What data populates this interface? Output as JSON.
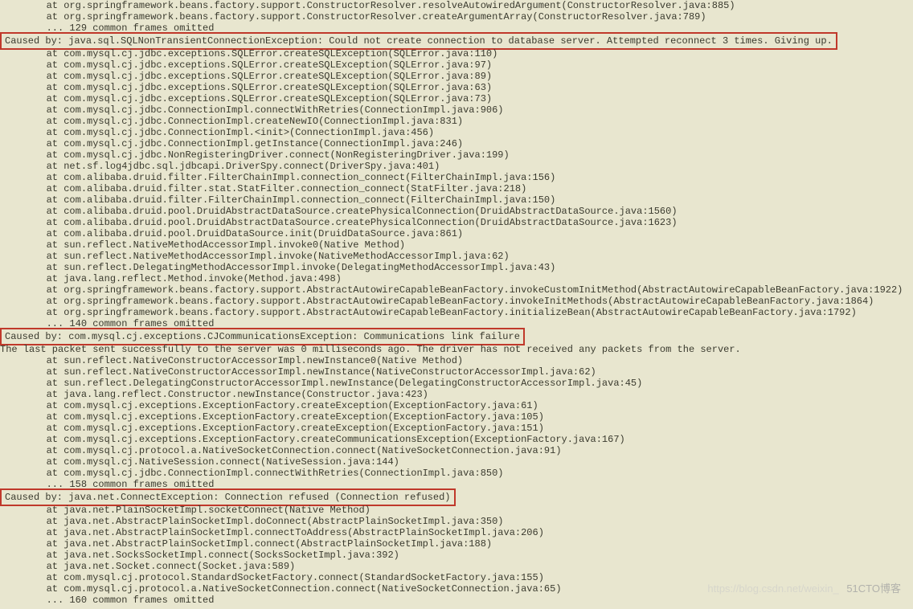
{
  "indent_at": "        at ",
  "indent_dots": "        ... ",
  "stack_top": [
    "org.springframework.beans.factory.support.ConstructorResolver.resolveAutowiredArgument(ConstructorResolver.java:885)",
    "org.springframework.beans.factory.support.ConstructorResolver.createArgumentArray(ConstructorResolver.java:789)"
  ],
  "omitted1": "129 common frames omitted",
  "caused1": "Caused by: java.sql.SQLNonTransientConnectionException: Could not create connection to database server. Attempted reconnect 3 times. Giving up.",
  "stack1": [
    "com.mysql.cj.jdbc.exceptions.SQLError.createSQLException(SQLError.java:110)",
    "com.mysql.cj.jdbc.exceptions.SQLError.createSQLException(SQLError.java:97)",
    "com.mysql.cj.jdbc.exceptions.SQLError.createSQLException(SQLError.java:89)",
    "com.mysql.cj.jdbc.exceptions.SQLError.createSQLException(SQLError.java:63)",
    "com.mysql.cj.jdbc.exceptions.SQLError.createSQLException(SQLError.java:73)",
    "com.mysql.cj.jdbc.ConnectionImpl.connectWithRetries(ConnectionImpl.java:906)",
    "com.mysql.cj.jdbc.ConnectionImpl.createNewIO(ConnectionImpl.java:831)",
    "com.mysql.cj.jdbc.ConnectionImpl.<init>(ConnectionImpl.java:456)",
    "com.mysql.cj.jdbc.ConnectionImpl.getInstance(ConnectionImpl.java:246)",
    "com.mysql.cj.jdbc.NonRegisteringDriver.connect(NonRegisteringDriver.java:199)",
    "net.sf.log4jdbc.sql.jdbcapi.DriverSpy.connect(DriverSpy.java:401)",
    "com.alibaba.druid.filter.FilterChainImpl.connection_connect(FilterChainImpl.java:156)",
    "com.alibaba.druid.filter.stat.StatFilter.connection_connect(StatFilter.java:218)",
    "com.alibaba.druid.filter.FilterChainImpl.connection_connect(FilterChainImpl.java:150)",
    "com.alibaba.druid.pool.DruidAbstractDataSource.createPhysicalConnection(DruidAbstractDataSource.java:1560)",
    "com.alibaba.druid.pool.DruidAbstractDataSource.createPhysicalConnection(DruidAbstractDataSource.java:1623)",
    "com.alibaba.druid.pool.DruidDataSource.init(DruidDataSource.java:861)",
    "sun.reflect.NativeMethodAccessorImpl.invoke0(Native Method)",
    "sun.reflect.NativeMethodAccessorImpl.invoke(NativeMethodAccessorImpl.java:62)",
    "sun.reflect.DelegatingMethodAccessorImpl.invoke(DelegatingMethodAccessorImpl.java:43)",
    "java.lang.reflect.Method.invoke(Method.java:498)",
    "org.springframework.beans.factory.support.AbstractAutowireCapableBeanFactory.invokeCustomInitMethod(AbstractAutowireCapableBeanFactory.java:1922)",
    "org.springframework.beans.factory.support.AbstractAutowireCapableBeanFactory.invokeInitMethods(AbstractAutowireCapableBeanFactory.java:1864)",
    "org.springframework.beans.factory.support.AbstractAutowireCapableBeanFactory.initializeBean(AbstractAutowireCapableBeanFactory.java:1792)"
  ],
  "omitted2": "140 common frames omitted",
  "caused2": "Caused by: com.mysql.cj.exceptions.CJCommunicationsException: Communications link failure",
  "blank_line": "",
  "last_packet": "The last packet sent successfully to the server was 0 milliseconds ago. The driver has not received any packets from the server.",
  "stack2": [
    "sun.reflect.NativeConstructorAccessorImpl.newInstance0(Native Method)",
    "sun.reflect.NativeConstructorAccessorImpl.newInstance(NativeConstructorAccessorImpl.java:62)",
    "sun.reflect.DelegatingConstructorAccessorImpl.newInstance(DelegatingConstructorAccessorImpl.java:45)",
    "java.lang.reflect.Constructor.newInstance(Constructor.java:423)",
    "com.mysql.cj.exceptions.ExceptionFactory.createException(ExceptionFactory.java:61)",
    "com.mysql.cj.exceptions.ExceptionFactory.createException(ExceptionFactory.java:105)",
    "com.mysql.cj.exceptions.ExceptionFactory.createException(ExceptionFactory.java:151)",
    "com.mysql.cj.exceptions.ExceptionFactory.createCommunicationsException(ExceptionFactory.java:167)",
    "com.mysql.cj.protocol.a.NativeSocketConnection.connect(NativeSocketConnection.java:91)",
    "com.mysql.cj.NativeSession.connect(NativeSession.java:144)",
    "com.mysql.cj.jdbc.ConnectionImpl.connectWithRetries(ConnectionImpl.java:850)"
  ],
  "omitted3": "158 common frames omitted",
  "caused3": "Caused by: java.net.ConnectException: Connection refused (Connection refused)",
  "stack3": [
    "java.net.PlainSocketImpl.socketConnect(Native Method)",
    "java.net.AbstractPlainSocketImpl.doConnect(AbstractPlainSocketImpl.java:350)",
    "java.net.AbstractPlainSocketImpl.connectToAddress(AbstractPlainSocketImpl.java:206)",
    "java.net.AbstractPlainSocketImpl.connect(AbstractPlainSocketImpl.java:188)",
    "java.net.SocksSocketImpl.connect(SocksSocketImpl.java:392)",
    "java.net.Socket.connect(Socket.java:589)",
    "com.mysql.cj.protocol.StandardSocketFactory.connect(StandardSocketFactory.java:155)",
    "com.mysql.cj.protocol.a.NativeSocketConnection.connect(NativeSocketConnection.java:65)"
  ],
  "omitted4": "160 common frames omitted",
  "watermark_left": "https://blog.csdn.net/weixin_",
  "watermark_right": "51CTO博客"
}
